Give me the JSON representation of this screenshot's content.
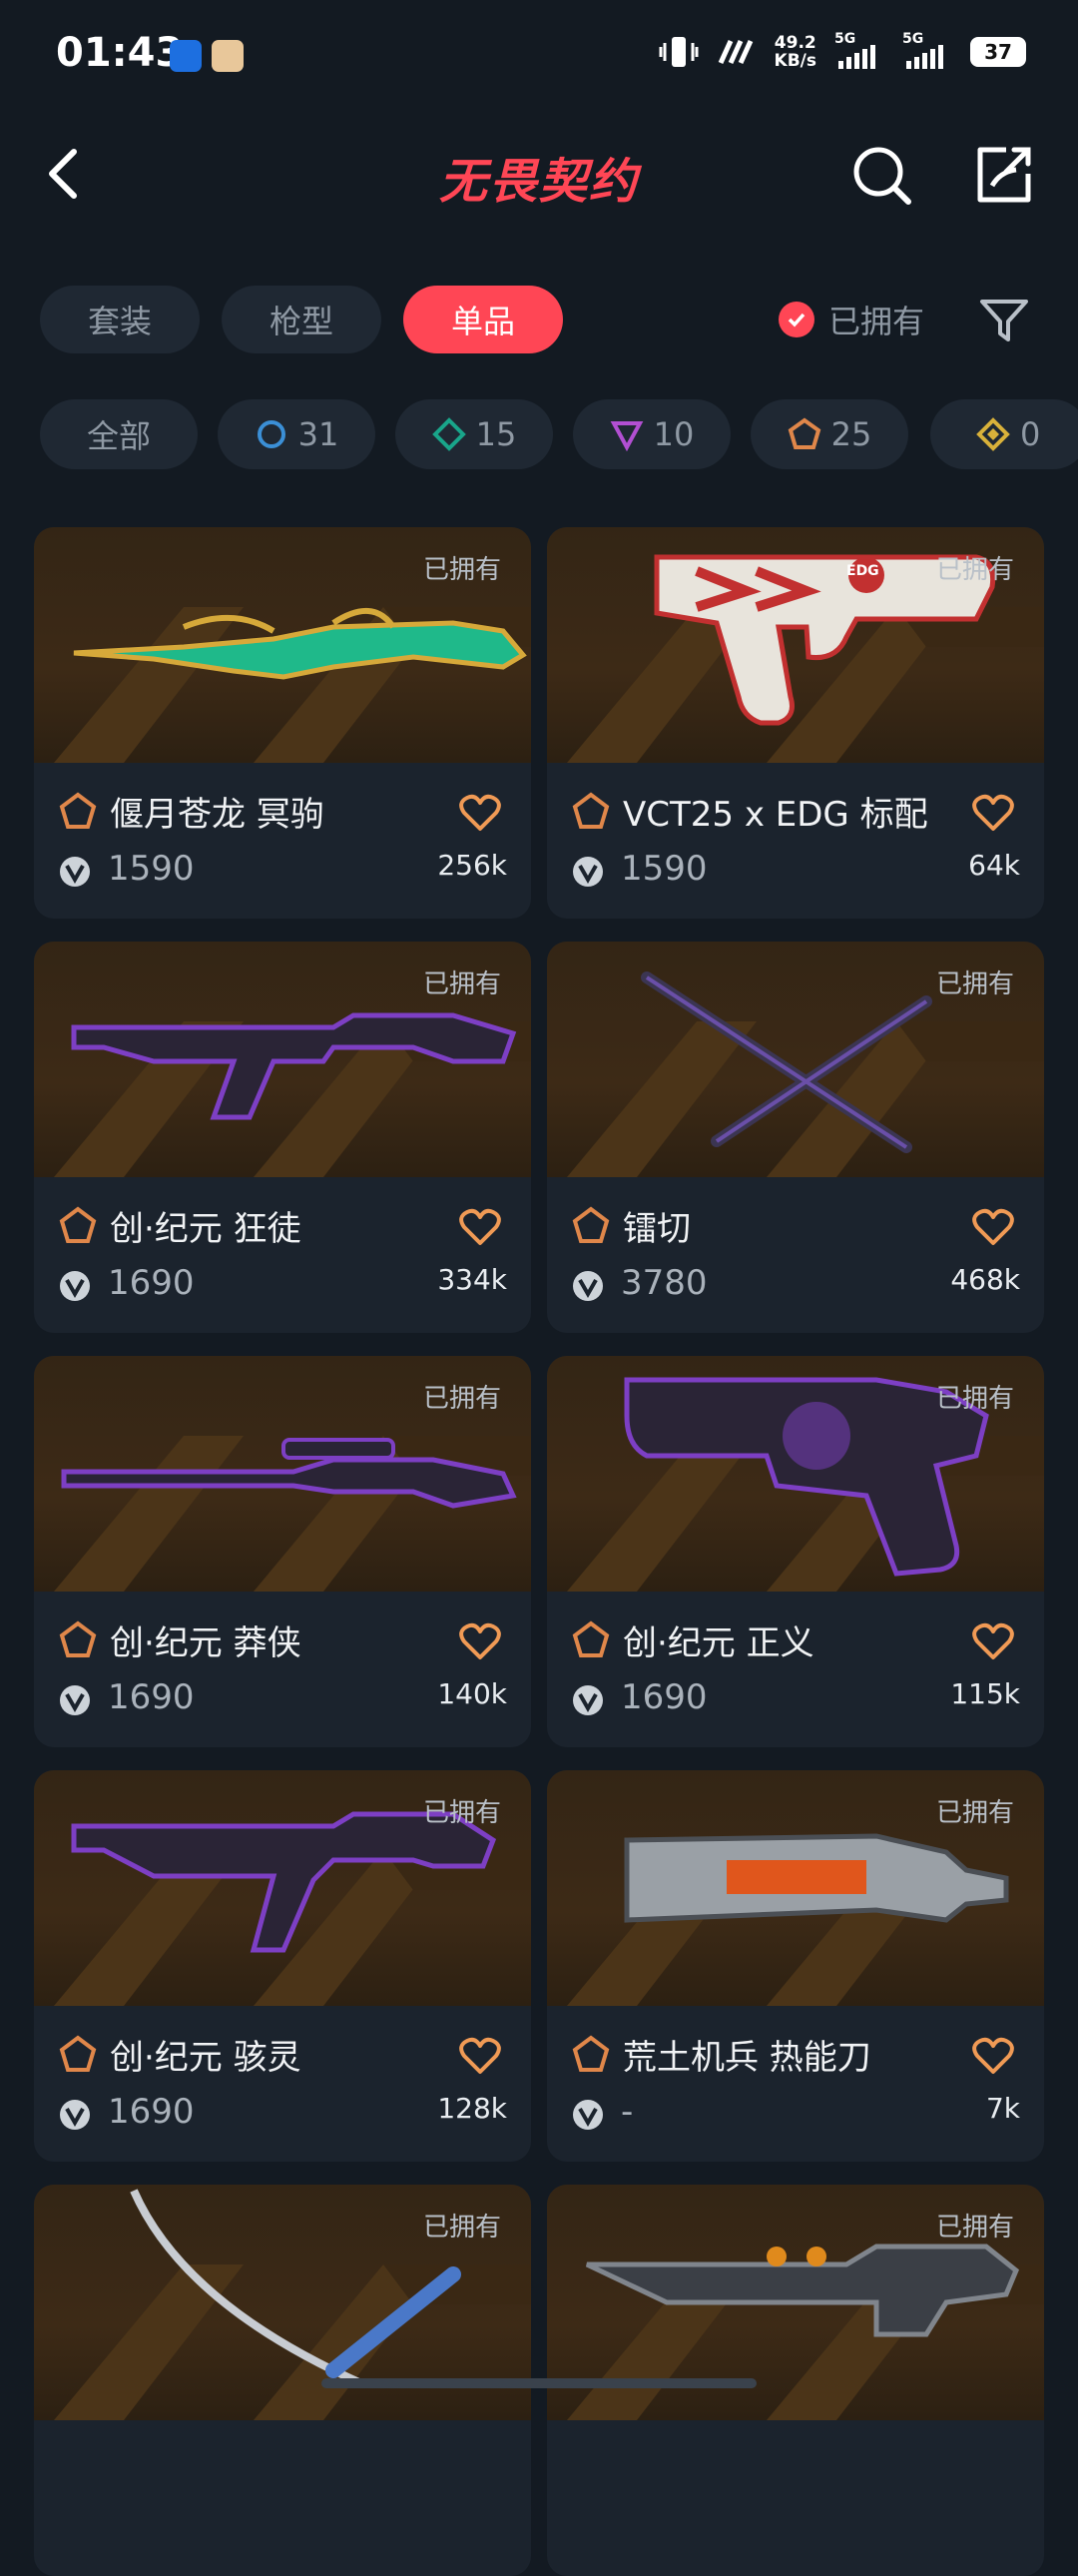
{
  "status_bar": {
    "time": "01:43",
    "netspeed_value": "49.2",
    "netspeed_unit": "KB/s",
    "sig1_label": "5G",
    "sig2_label": "5G",
    "battery": "37"
  },
  "header": {
    "title": "无畏契约",
    "back_icon": "chevron-left-icon",
    "search_icon": "search-icon",
    "share_icon": "share-icon"
  },
  "filters": {
    "tabs": [
      {
        "label": "套装",
        "active": false
      },
      {
        "label": "枪型",
        "active": false
      },
      {
        "label": "单品",
        "active": true
      }
    ],
    "owned_label": "已拥有",
    "owned_checked": true,
    "filter_icon": "funnel-icon"
  },
  "tiers": [
    {
      "label": "全部"
    },
    {
      "label": "31",
      "icon": "circle-tier-icon",
      "color": "#3b8fd6"
    },
    {
      "label": "15",
      "icon": "diamond-tier-icon",
      "color": "#19a58a"
    },
    {
      "label": "10",
      "icon": "triangle-tier-icon",
      "color": "#b24fd2"
    },
    {
      "label": "25",
      "icon": "pentagon-tier-icon",
      "color": "#e0874a"
    },
    {
      "label": "0",
      "icon": "rhombus-tier-icon",
      "color": "#d8b13a"
    }
  ],
  "items": [
    {
      "name": "偃月苍龙 冥驹",
      "price": "1590",
      "likes": "256k",
      "owned": "已拥有",
      "weapon": "sniper-rifle-icon",
      "accent": "#1fb98a"
    },
    {
      "name": "VCT25 x EDG 标配",
      "price": "1590",
      "likes": "64k",
      "owned": "已拥有",
      "weapon": "pistol-icon",
      "accent": "#c23030",
      "decal": "EDG"
    },
    {
      "name": "创·纪元 狂徒",
      "price": "1690",
      "likes": "334k",
      "owned": "已拥有",
      "weapon": "rifle-icon",
      "accent": "#7d3fc4"
    },
    {
      "name": "镭切",
      "price": "3780",
      "likes": "468k",
      "owned": "已拥有",
      "weapon": "twin-blades-icon",
      "accent": "#6a4fa8"
    },
    {
      "name": "创·纪元 莽侠",
      "price": "1690",
      "likes": "140k",
      "owned": "已拥有",
      "weapon": "marksman-rifle-icon",
      "accent": "#7d3fc4"
    },
    {
      "name": "创·纪元 正义",
      "price": "1690",
      "likes": "115k",
      "owned": "已拥有",
      "weapon": "revolver-icon",
      "accent": "#7d3fc4"
    },
    {
      "name": "创·纪元 骇灵",
      "price": "1690",
      "likes": "128k",
      "owned": "已拥有",
      "weapon": "smg-icon",
      "accent": "#7d3fc4"
    },
    {
      "name": "荒土机兵 热能刀",
      "price": "-",
      "likes": "7k",
      "owned": "已拥有",
      "weapon": "heat-knife-icon",
      "accent": "#e0561c"
    },
    {
      "name": "",
      "price": "",
      "likes": "",
      "owned": "已拥有",
      "weapon": "katana-icon",
      "accent": "#4a78c8"
    },
    {
      "name": "",
      "price": "",
      "likes": "",
      "owned": "已拥有",
      "weapon": "shotgun-icon",
      "accent": "#e08a1c"
    }
  ],
  "colors": {
    "background": "#131a22",
    "accent": "#ff4655",
    "card": "#1b232d",
    "heart": "#f09a55"
  }
}
